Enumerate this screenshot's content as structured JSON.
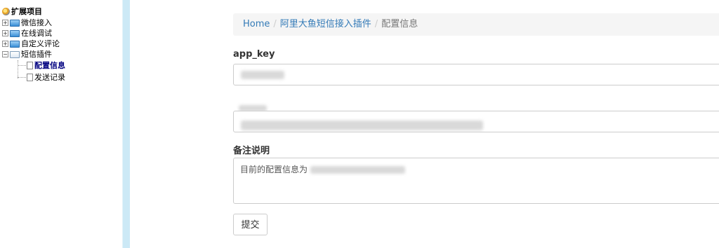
{
  "tree": {
    "root_label": "扩展项目",
    "items": [
      {
        "label": "微信接入",
        "toggle": "+"
      },
      {
        "label": "在线调试",
        "toggle": "+"
      },
      {
        "label": "自定义评论",
        "toggle": "+"
      },
      {
        "label": "短信插件",
        "toggle": "−"
      }
    ],
    "children": [
      {
        "label": "配置信息",
        "selected": true
      },
      {
        "label": "发送记录",
        "selected": false
      }
    ]
  },
  "breadcrumb": {
    "home": "Home",
    "separator": "/",
    "plugin": "阿里大鱼短信接入插件",
    "current": "配置信息"
  },
  "form": {
    "app_key_label": "app_key",
    "remark_label": "备注说明",
    "remark_value": "目前的配置信息为",
    "submit_label": "提交"
  },
  "colors": {
    "link": "#337ab7",
    "divider": "#cce9f6"
  }
}
